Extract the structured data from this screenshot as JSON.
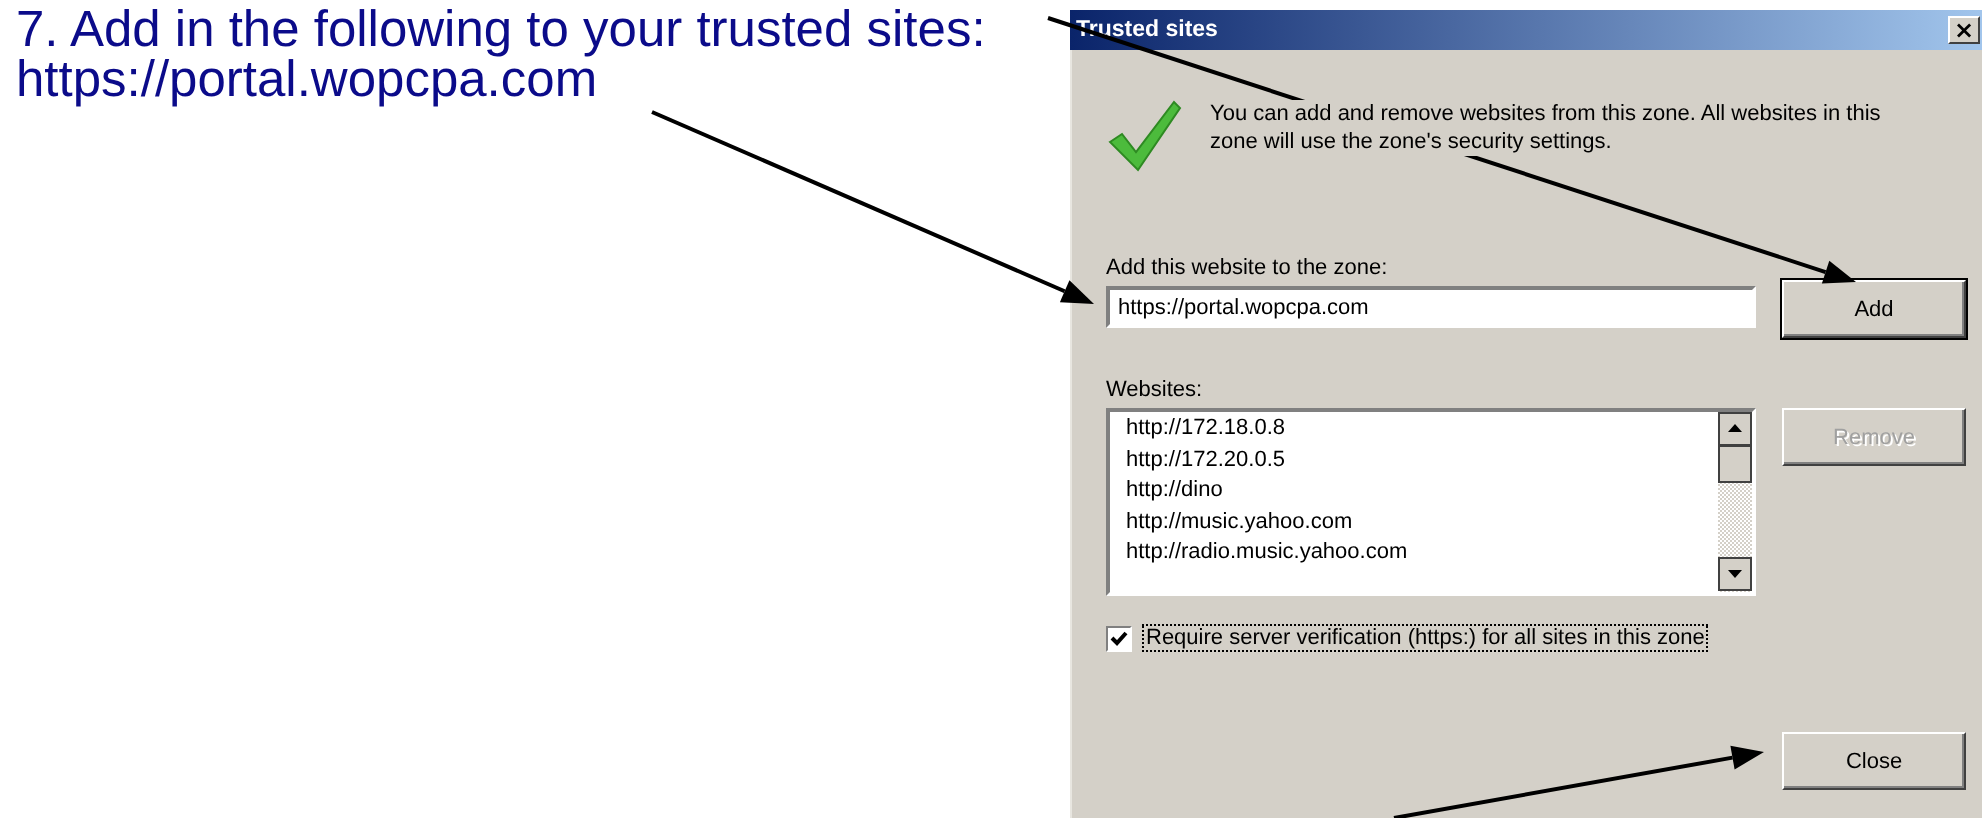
{
  "instruction": {
    "lines": [
      "7. Add in the following to your trusted sites:",
      "https://portal.wopcpa.com"
    ]
  },
  "dialog": {
    "title": "Trusted sites",
    "close_glyph": "×",
    "description": "You can add and remove websites from this zone. All websites in this zone will use the zone's security settings.",
    "add_label": "Add this website to the zone:",
    "add_field": {
      "value": "https://portal.wopcpa.com"
    },
    "add_button": {
      "label": "Add",
      "disabled": false
    },
    "websites_label": "Websites:",
    "websites": [
      {
        "url": "http://172.18.0.8",
        "selected": false
      },
      {
        "url": "http://172.20.0.5",
        "selected": false
      },
      {
        "url": "http://dino",
        "selected": false
      },
      {
        "url": "http://music.yahoo.com",
        "selected": false
      },
      {
        "url": "http://radio.music.yahoo.com",
        "selected": false
      }
    ],
    "remove_button": {
      "label": "Remove",
      "disabled": true
    },
    "require_https": {
      "label": "Require server verification (https:) for all sites in this zone",
      "checked": true
    },
    "close_button": {
      "label": "Close",
      "disabled": false
    }
  }
}
